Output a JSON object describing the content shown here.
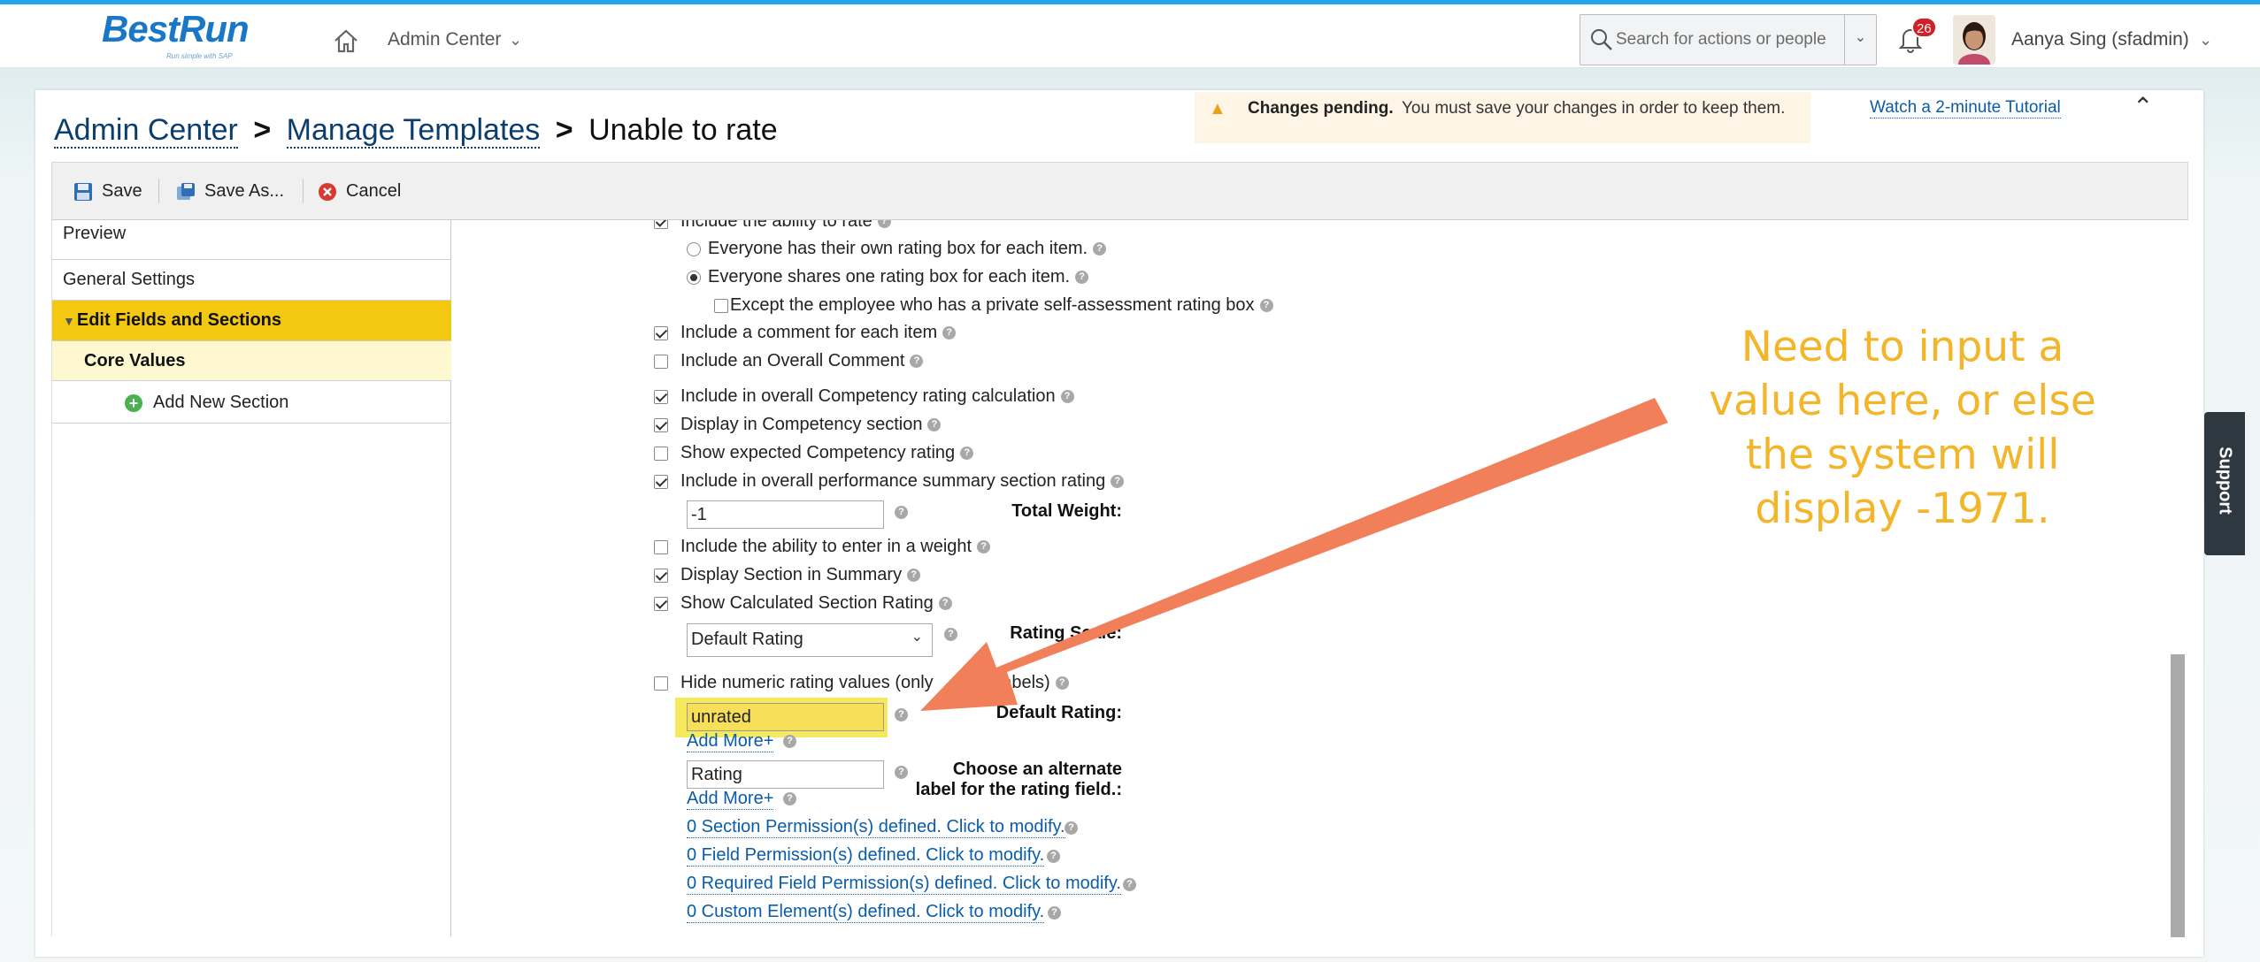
{
  "header": {
    "logo": "BestRun",
    "logo_tagline": "Run simple with SAP",
    "nav_label": "Admin Center",
    "search_placeholder": "Search for actions or people",
    "notification_count": "26",
    "user_name": "Aanya Sing (sfadmin)"
  },
  "breadcrumb": {
    "item1": "Admin Center",
    "item2": "Manage Templates",
    "current": "Unable to rate",
    "separator": ">"
  },
  "banner": {
    "bold": "Changes pending.",
    "text": "You must save your changes in order to keep them.",
    "tutorial_link": "Watch a 2-minute Tutorial"
  },
  "toolbar": {
    "save_label": "Save",
    "save_as_label": "Save As...",
    "cancel_label": "Cancel"
  },
  "sidebar": {
    "items": [
      {
        "label": "Preview"
      },
      {
        "label": "General Settings"
      },
      {
        "label": "Edit Fields and Sections"
      },
      {
        "label": "Core Values"
      },
      {
        "label": "Add New Section"
      }
    ]
  },
  "form": {
    "include_rate": "Include the ability to rate",
    "opt_own": "Everyone has their own rating box for each item.",
    "opt_shared": "Everyone shares one rating box for each item.",
    "except_employee": "Except the employee who has a private self-assessment rating box",
    "comment_each": "Include a comment for each item",
    "overall_comment": "Include an Overall Comment",
    "overall_competency_calc": "Include in overall Competency rating calculation",
    "display_competency": "Display in Competency section",
    "show_expected": "Show expected Competency rating",
    "overall_perf_summary": "Include in overall performance summary section rating",
    "total_weight_label": "Total Weight:",
    "total_weight_value": "-1",
    "enter_weight": "Include the ability to enter in a weight",
    "display_summary": "Display Section in Summary",
    "show_calc_rating": "Show Calculated Section Rating",
    "rating_scale_label": "Rating Scale:",
    "rating_scale_value": "Default Rating",
    "hide_numeric_a": "Hide numeric rating values (only",
    "hide_numeric_b": "xt labels)",
    "default_rating_label": "Default Rating:",
    "default_rating_value": "unrated",
    "add_more": "Add More+",
    "alt_label_line1": "Choose an alternate",
    "alt_label_line2": "label for the rating field.:",
    "alt_label_value": "Rating",
    "section_permissions": "0 Section Permission(s) defined. Click to modify.",
    "field_permissions": "0 Field Permission(s) defined. Click to modify.",
    "required_field_permissions": "0 Required Field Permission(s) defined. Click to modify.",
    "custom_elements": "0 Custom Element(s) defined. Click to modify."
  },
  "support_label": "Support",
  "annotation": {
    "text": "Need to input a value here, or else the system will display -1971.",
    "color": "#f3b52a",
    "arrow_color": "#f07f5a",
    "highlight_color": "#f6e95c"
  },
  "colors": {
    "accent": "#1ea6e6",
    "selected_nav": "#f2c811",
    "link": "#0a5da8"
  }
}
